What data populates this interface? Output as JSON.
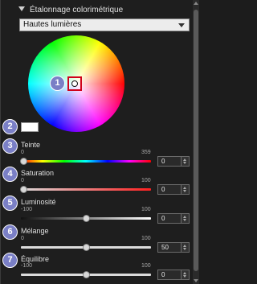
{
  "section": {
    "title": "Étalonnage colorimétrique"
  },
  "mode_dropdown": {
    "selected": "Hautes lumières"
  },
  "callouts": [
    "1",
    "2",
    "3",
    "4",
    "5",
    "6",
    "7"
  ],
  "colors": {
    "callout_bg": "#7a7fc6",
    "picker_border": "#d0021b",
    "swatch": "#ffffff"
  },
  "sliders": {
    "teinte": {
      "label": "Teinte",
      "min": "0",
      "max": "359",
      "value": "0",
      "position": 0.0
    },
    "saturation": {
      "label": "Saturation",
      "min": "0",
      "max": "100",
      "value": "0",
      "position": 0.0
    },
    "luminosite": {
      "label": "Luminosité",
      "min": "-100",
      "max": "100",
      "value": "0",
      "position": 0.5
    },
    "melange": {
      "label": "Mélange",
      "min": "0",
      "max": "100",
      "value": "50",
      "position": 0.5
    },
    "equilibre": {
      "label": "Équilibre",
      "min": "-100",
      "max": "100",
      "value": "0",
      "position": 0.5
    }
  }
}
